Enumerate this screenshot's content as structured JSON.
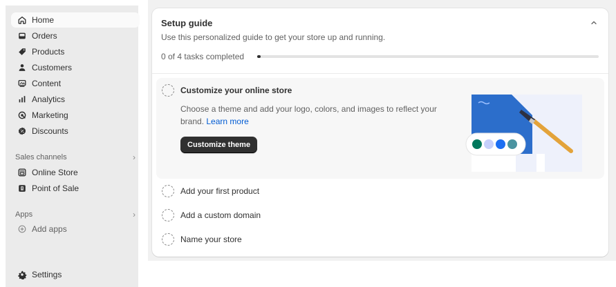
{
  "sidebar": {
    "items": [
      {
        "label": "Home",
        "icon": "home-icon",
        "active": true
      },
      {
        "label": "Orders",
        "icon": "orders-icon"
      },
      {
        "label": "Products",
        "icon": "tag-icon"
      },
      {
        "label": "Customers",
        "icon": "person-icon"
      },
      {
        "label": "Content",
        "icon": "content-icon"
      },
      {
        "label": "Analytics",
        "icon": "bar-chart-icon"
      },
      {
        "label": "Marketing",
        "icon": "target-icon"
      },
      {
        "label": "Discounts",
        "icon": "discount-icon"
      }
    ],
    "sales_channels": {
      "label": "Sales channels",
      "items": [
        {
          "label": "Online Store",
          "icon": "store-icon"
        },
        {
          "label": "Point of Sale",
          "icon": "pos-icon"
        }
      ]
    },
    "apps": {
      "label": "Apps",
      "add_label": "Add apps"
    },
    "settings_label": "Settings"
  },
  "setup_guide": {
    "title": "Setup guide",
    "subtitle": "Use this personalized guide to get your store up and running.",
    "progress_label": "0 of 4 tasks completed",
    "progress_fraction": 0.01,
    "active_task": {
      "title": "Customize your online store",
      "description": "Choose a theme and add your logo, colors, and images to reflect your brand.",
      "link_label": "Learn more",
      "button_label": "Customize theme"
    },
    "tasks": [
      {
        "title": "Add your first product"
      },
      {
        "title": "Add a custom domain"
      },
      {
        "title": "Name your store"
      }
    ]
  },
  "colors": {
    "illustration_blue": "#2c6ecb",
    "swatches": [
      "#00785c",
      "#c6cffb",
      "#1c6ef2",
      "#4a93a0"
    ]
  }
}
